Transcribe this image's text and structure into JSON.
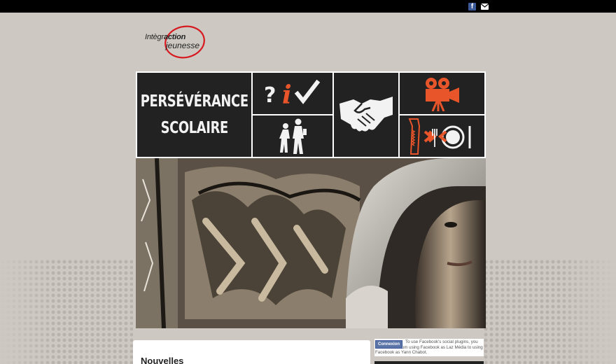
{
  "header": {
    "social_icons": [
      "facebook-icon",
      "mail-icon"
    ],
    "facebook_glyph": "f"
  },
  "logo": {
    "line1_prefix": "Intègr",
    "line1_bold": "action",
    "line2": "jeunesse",
    "ring_color": "#d71920"
  },
  "menu": {
    "main_tile": {
      "line1": "PERSÉVÉRANCE",
      "line2": "SCOLAIRE"
    },
    "tiles": [
      {
        "icon": "question-info-check-icon"
      },
      {
        "icon": "walking-kids-icon"
      },
      {
        "icon": "handshake-icon"
      },
      {
        "icon": "movie-camera-icon"
      },
      {
        "icon": "saw-arrow-plate-icon"
      }
    ],
    "accent_color": "#e8552a"
  },
  "hero": {
    "image": "graffiti-hooded-youth"
  },
  "news": {
    "title": "Nouvelles"
  },
  "facebook_plugin": {
    "button_label": "Connexion",
    "message": "To use Facebook's social plugins, you must switch from using Facebook as Laz Média to using Facebook as Yann Chabot."
  }
}
